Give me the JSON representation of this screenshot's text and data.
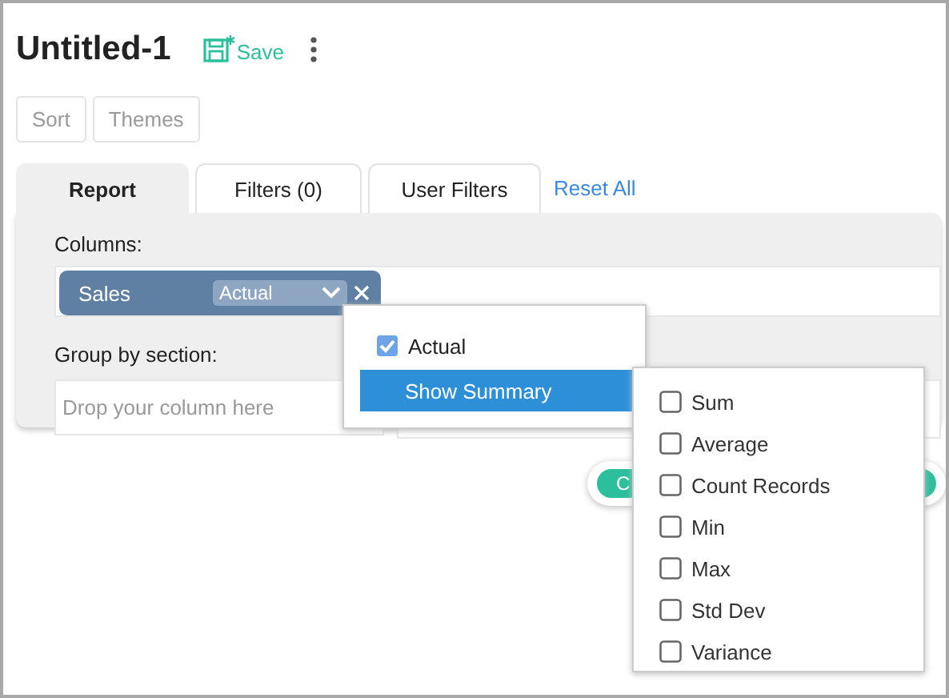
{
  "title": "Untitled-1",
  "save": "Save",
  "toolbar": [
    "Sort",
    "Themes"
  ],
  "tabs": [
    {
      "label": "Report",
      "selected": true
    },
    {
      "label": "Filters (0)",
      "selected": false
    },
    {
      "label": "User Filters",
      "selected": false
    }
  ],
  "reset": "Reset All",
  "columns": {
    "label": "Columns:",
    "chip": {
      "name": "Sales",
      "aggregate": "Actual"
    }
  },
  "group_by": {
    "label": "Group by section:",
    "placeholder": "Drop your column here"
  },
  "action_button": "C",
  "menu": {
    "items": [
      {
        "kind": "check",
        "label": "Actual",
        "checked": true,
        "selected": false
      },
      {
        "kind": "submenu",
        "label": "Show Summary",
        "selected": true
      }
    ]
  },
  "submenu": {
    "items": [
      {
        "label": "Sum",
        "checked": false
      },
      {
        "label": "Average",
        "checked": false
      },
      {
        "label": "Count Records",
        "checked": false
      },
      {
        "label": "Min",
        "checked": false
      },
      {
        "label": "Max",
        "checked": false
      },
      {
        "label": "Std Dev",
        "checked": false
      },
      {
        "label": "Variance",
        "checked": false
      }
    ]
  }
}
